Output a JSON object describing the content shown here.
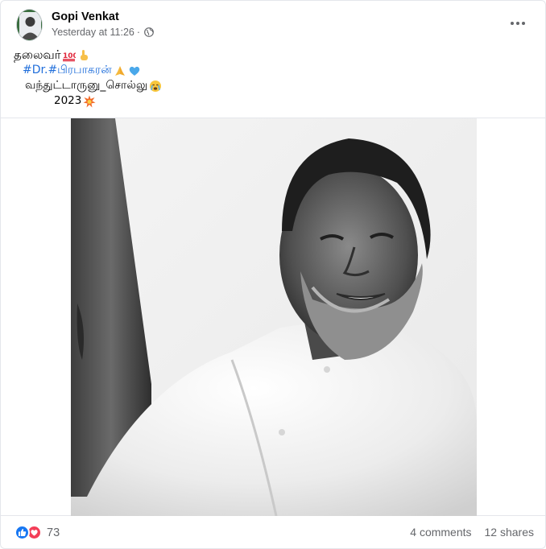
{
  "post": {
    "author": "Gopi Venkat",
    "time": "Yesterday at 11:26",
    "separator": "·",
    "privacy_icon": "globe-icon",
    "more_icon": "more-horizontal-icon"
  },
  "caption": {
    "line1_text": "தலைவர்",
    "line1_emojis": [
      "hundred-points-emoji",
      "backhand-index-pointing-down-emoji"
    ],
    "line2_hashtag1": "#Dr.",
    "line2_hashtag2": "#பிரபாகரன்",
    "line2_emojis": [
      "folded-hands-emoji",
      "blue-heart-emoji"
    ],
    "line3_text": "வந்துட்டாருனு_சொல்லு",
    "line3_emojis": [
      "crying-face-emoji"
    ],
    "line4_text": "2023",
    "line4_emojis": [
      "collision-emoji"
    ]
  },
  "photo": {
    "style": "black-and-white portrait"
  },
  "footer": {
    "reaction_icons": [
      "like-icon",
      "love-icon"
    ],
    "reaction_count": "73",
    "comments": "4 comments",
    "shares": "12 shares"
  },
  "colors": {
    "link_blue": "#216fdb",
    "meta_gray": "#65676b",
    "like_blue": "#1877f2",
    "love_red": "#f33e58"
  }
}
